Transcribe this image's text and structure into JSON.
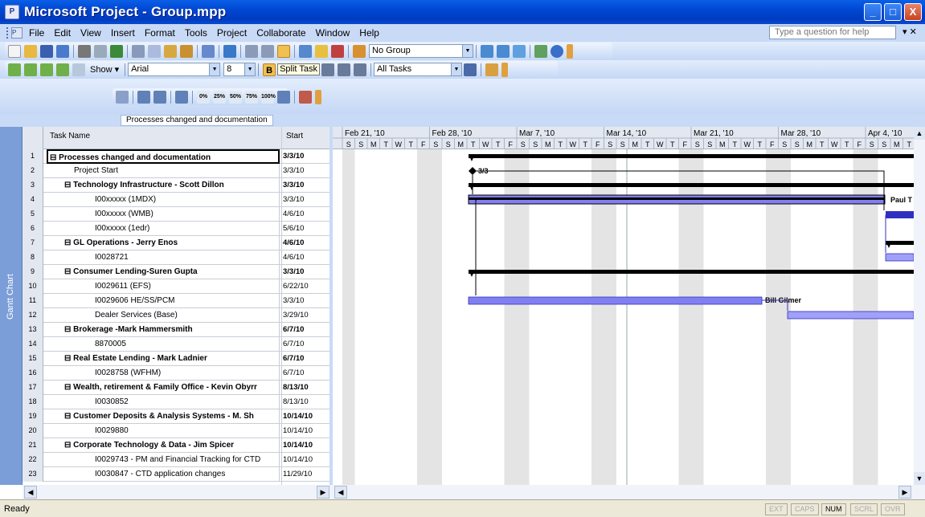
{
  "window": {
    "title": "Microsoft Project - Group.mpp",
    "min": "_",
    "max": "□",
    "close": "X"
  },
  "menu": {
    "items": [
      "File",
      "Edit",
      "View",
      "Insert",
      "Format",
      "Tools",
      "Project",
      "Collaborate",
      "Window",
      "Help"
    ],
    "help_placeholder": "Type a question for help",
    "ctrl": "▾ ✕"
  },
  "toolbar1": {
    "group_value": "No Group"
  },
  "toolbar2": {
    "show_label": "Show ▾",
    "font_value": "Arial",
    "size_value": "8",
    "split_task_label": "Split Task",
    "filter_value": "All Tasks",
    "bold_label": "B"
  },
  "toolbar3": {
    "labels": [
      "0%",
      "25%",
      "50%",
      "75%",
      "100%"
    ]
  },
  "entry_bar": {
    "value": "Processes changed and documentation"
  },
  "sidebar": {
    "view_label": "Gantt Chart"
  },
  "table": {
    "headers": {
      "task_name": "Task Name",
      "start": "Start"
    },
    "rows": [
      {
        "id": "1",
        "name": "Processes changed and documentation",
        "start": "3/3/10",
        "summary": true,
        "indent": 0
      },
      {
        "id": "2",
        "name": "Project Start",
        "start": "3/3/10",
        "summary": false,
        "indent": 1
      },
      {
        "id": "3",
        "name": "Technology Infrastructure - Scott Dillon",
        "start": "3/3/10",
        "summary": true,
        "indent": 1
      },
      {
        "id": "4",
        "name": "I00xxxxx (1MDX)",
        "start": "3/3/10",
        "summary": false,
        "indent": 2
      },
      {
        "id": "5",
        "name": "I00xxxxx (WMB)",
        "start": "4/6/10",
        "summary": false,
        "indent": 2
      },
      {
        "id": "6",
        "name": "I00xxxxx (1edr)",
        "start": "5/6/10",
        "summary": false,
        "indent": 2
      },
      {
        "id": "7",
        "name": "GL Operations - Jerry Enos",
        "start": "4/6/10",
        "summary": true,
        "indent": 1
      },
      {
        "id": "8",
        "name": "I0028721",
        "start": "4/6/10",
        "summary": false,
        "indent": 2
      },
      {
        "id": "9",
        "name": "Consumer Lending-Suren Gupta",
        "start": "3/3/10",
        "summary": true,
        "indent": 1
      },
      {
        "id": "10",
        "name": "I0029611 (EFS)",
        "start": "6/22/10",
        "summary": false,
        "indent": 2
      },
      {
        "id": "11",
        "name": "I0029606 HE/SS/PCM",
        "start": "3/3/10",
        "summary": false,
        "indent": 2
      },
      {
        "id": "12",
        "name": "Dealer Services (Base)",
        "start": "3/29/10",
        "summary": false,
        "indent": 2
      },
      {
        "id": "13",
        "name": "Brokerage -Mark Hammersmith",
        "start": "6/7/10",
        "summary": true,
        "indent": 1
      },
      {
        "id": "14",
        "name": "8870005",
        "start": "6/7/10",
        "summary": false,
        "indent": 2
      },
      {
        "id": "15",
        "name": "Real Estate Lending - Mark Ladnier",
        "start": "6/7/10",
        "summary": true,
        "indent": 1
      },
      {
        "id": "16",
        "name": "I0028758 (WFHM)",
        "start": "6/7/10",
        "summary": false,
        "indent": 2
      },
      {
        "id": "17",
        "name": "Wealth, retirement & Family Office - Kevin Obyrr",
        "start": "8/13/10",
        "summary": true,
        "indent": 1
      },
      {
        "id": "18",
        "name": "I0030852",
        "start": "8/13/10",
        "summary": false,
        "indent": 2
      },
      {
        "id": "19",
        "name": "Customer Deposits & Analysis Systems - M. Sh",
        "start": "10/14/10",
        "summary": true,
        "indent": 1
      },
      {
        "id": "20",
        "name": "I0029880",
        "start": "10/14/10",
        "summary": false,
        "indent": 2
      },
      {
        "id": "21",
        "name": "Corporate Technology & Data - Jim Spicer",
        "start": "10/14/10",
        "summary": true,
        "indent": 1
      },
      {
        "id": "22",
        "name": "I0029743 - PM and Financial Tracking for CTD",
        "start": "10/14/10",
        "summary": false,
        "indent": 2
      },
      {
        "id": "23",
        "name": "I0030847 - CTD application changes",
        "start": "11/29/10",
        "summary": false,
        "indent": 2
      }
    ]
  },
  "gantt": {
    "weeks": [
      "Feb 21, '10",
      "Feb 28, '10",
      "Mar 7, '10",
      "Mar 14, '10",
      "Mar 21, '10",
      "Mar 28, '10",
      "Apr 4, '10"
    ],
    "days": [
      "S",
      "S",
      "M",
      "T",
      "W",
      "T",
      "F"
    ],
    "milestone_label": "3/3",
    "resource_labels": [
      "Paul T",
      "Bill Gilmer"
    ]
  },
  "status": {
    "ready": "Ready",
    "indicators": [
      "EXT",
      "CAPS",
      "NUM",
      "SCRL",
      "OVR"
    ],
    "active": "NUM"
  }
}
